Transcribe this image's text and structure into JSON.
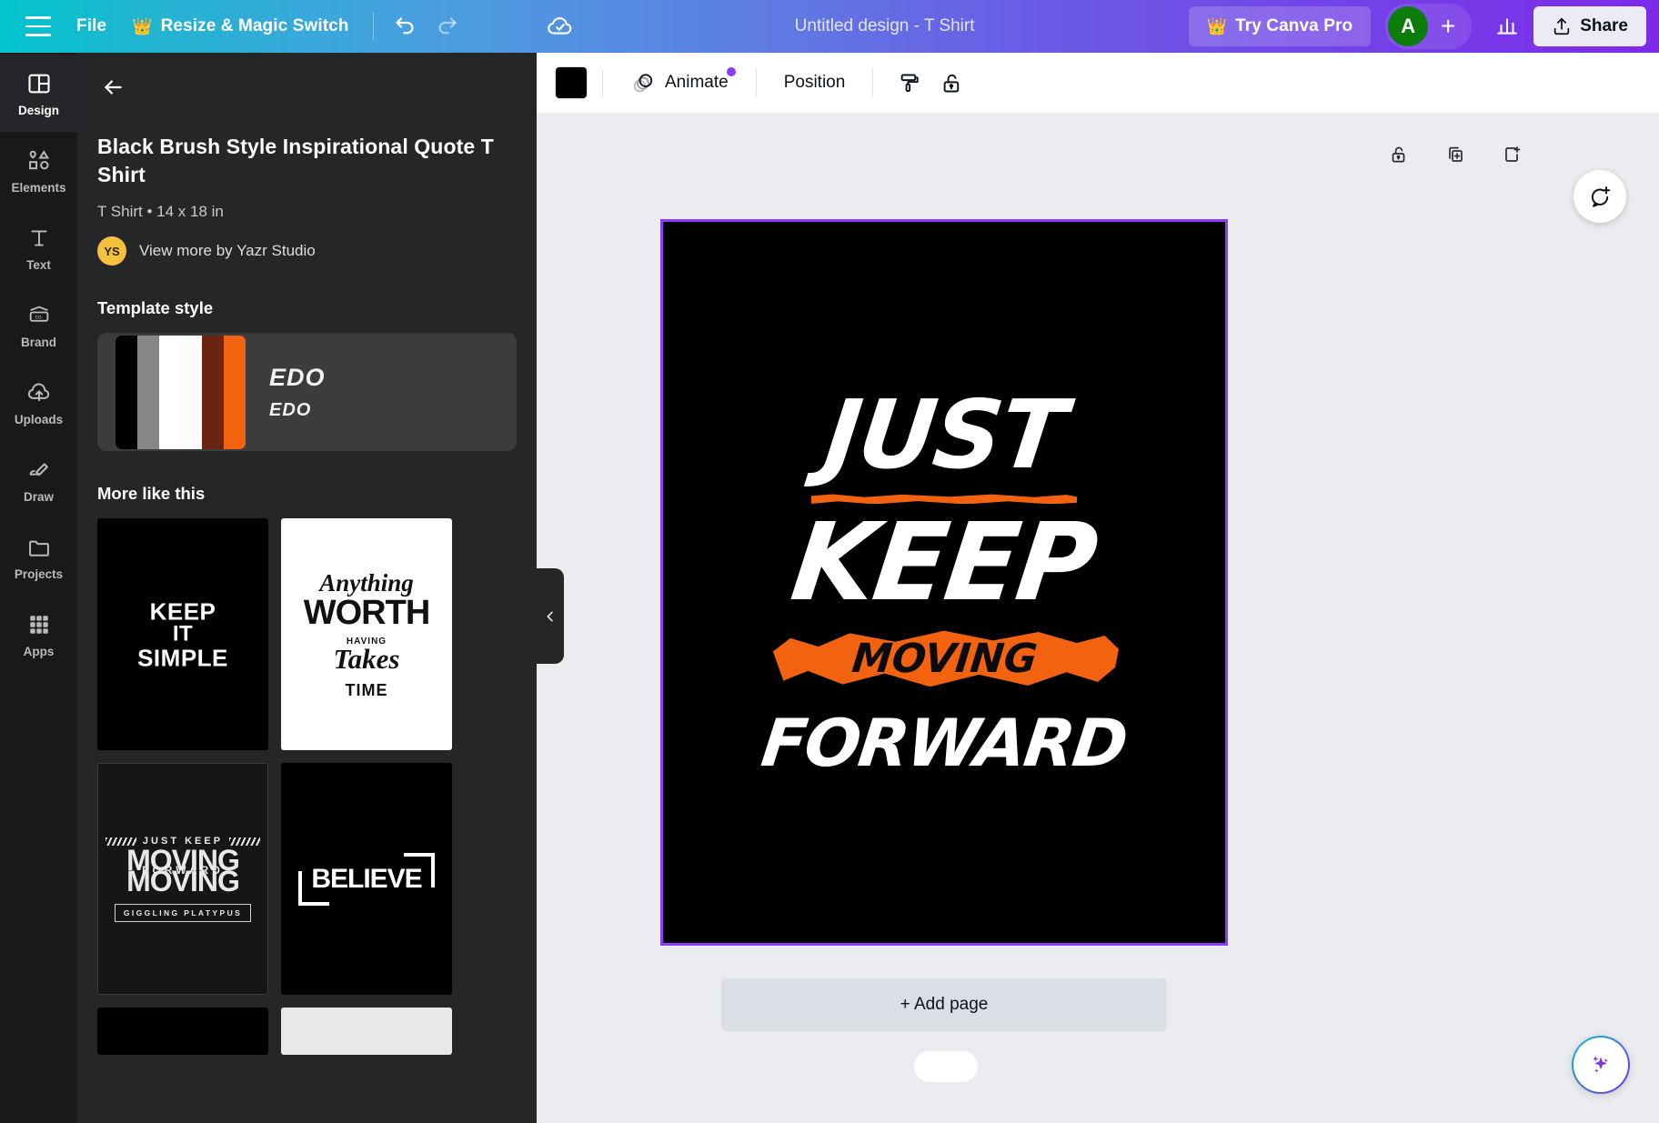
{
  "topbar": {
    "menu_icon": "hamburger-icon",
    "file_label": "File",
    "resize_label": "Resize & Magic Switch",
    "crown_icon": "crown-icon",
    "undo_icon": "undo-icon",
    "redo_icon": "redo-icon",
    "cloud_icon": "cloud-saved-icon",
    "doc_title": "Untitled design - T Shirt",
    "try_pro_label": "Try Canva Pro",
    "avatar_initial": "A",
    "plus_label": "+",
    "insights_icon": "bar-chart-icon",
    "share_label": "Share",
    "share_icon": "upload-icon"
  },
  "rail": {
    "items": [
      {
        "label": "Design",
        "icon": "layout-icon",
        "active": true
      },
      {
        "label": "Elements",
        "icon": "shapes-icon",
        "active": false
      },
      {
        "label": "Text",
        "icon": "text-t-icon",
        "active": false
      },
      {
        "label": "Brand",
        "icon": "brand-card-icon",
        "active": false
      },
      {
        "label": "Uploads",
        "icon": "cloud-upload-icon",
        "active": false
      },
      {
        "label": "Draw",
        "icon": "pen-icon",
        "active": false
      },
      {
        "label": "Projects",
        "icon": "folder-icon",
        "active": false
      },
      {
        "label": "Apps",
        "icon": "grid-dots-icon",
        "active": false
      }
    ]
  },
  "panel": {
    "back_icon": "arrow-left-icon",
    "template_title": "Black Brush Style Inspirational Quote T Shirt",
    "template_meta": "T Shirt • 14 x 18 in",
    "author_initials": "YS",
    "author_link": "View more by Yazr Studio",
    "style_heading": "Template style",
    "style_swatches": [
      "#000000",
      "#878787",
      "#ffffff",
      "#fcfcfc",
      "#6b2410",
      "#f2620f"
    ],
    "style_font_large": "EDO",
    "style_font_small": "EDO",
    "more_heading": "More like this",
    "thumbs": [
      {
        "name": "keep-it-simple",
        "lines": [
          "KEEP",
          "IT",
          "SIMPLE"
        ]
      },
      {
        "name": "anything-worth-having-takes-time",
        "lines": [
          "Anything",
          "WORTH",
          "HAVING",
          "Takes",
          "TIME"
        ]
      },
      {
        "name": "just-keep-moving-forward-giggling-platypus",
        "lines": [
          "JUST KEEP",
          "MOVING",
          "FORWARD",
          "MOVING",
          "GIGGLING PLATYPUS"
        ]
      },
      {
        "name": "believe",
        "lines": [
          "BELIEVE"
        ]
      }
    ],
    "collapse_icon": "chevron-left-icon"
  },
  "editor_toolbar": {
    "color_chip": "#000000",
    "animate_label": "Animate",
    "animate_icon": "animate-shapes-icon",
    "position_label": "Position",
    "paint_icon": "paint-roller-icon",
    "lock_icon": "lock-open-icon"
  },
  "page_tools": {
    "lock_icon": "lock-open-icon",
    "duplicate_icon": "duplicate-page-icon",
    "addpage_icon": "add-page-icon",
    "comment_icon": "comment-add-icon"
  },
  "canvas": {
    "design_lines": [
      "JUST",
      "KEEP",
      "MOVING",
      "FORWARD"
    ],
    "accent_color": "#f2620f",
    "background_color": "#000000",
    "text_color": "#ffffff",
    "selection_color": "#8b3dff"
  },
  "footer": {
    "add_page_label": "+ Add page",
    "ai_icon": "magic-sparkle-icon"
  }
}
